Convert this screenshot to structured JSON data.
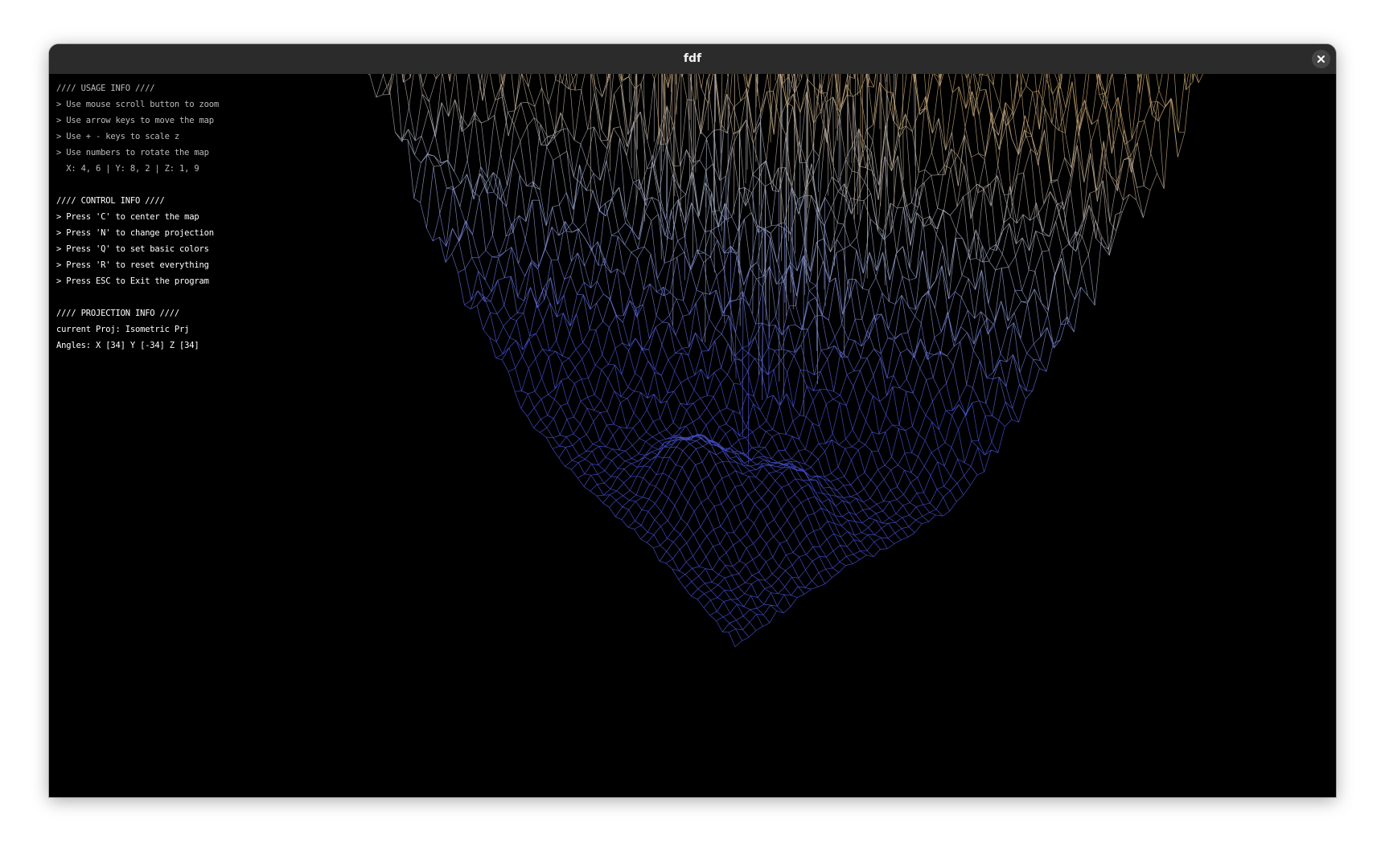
{
  "window": {
    "title": "fdf"
  },
  "icons": {
    "close": "close-icon"
  },
  "colors": {
    "titlebar": "#2b2b2b",
    "background": "#000000",
    "low": "#4a55e0",
    "mid": "#9aa7c8",
    "tan": "#c8a772",
    "high": "#e8e8e8",
    "green": "#8ab84a"
  },
  "hud": {
    "usage": {
      "header": "//// USAGE INFO ////",
      "lines": [
        "> Use mouse scroll button to zoom",
        "> Use arrow keys to move the map",
        "> Use + - keys to scale z",
        "> Use numbers to rotate the map",
        "  X: 4, 6 | Y: 8, 2 | Z: 1, 9"
      ]
    },
    "control": {
      "header": "//// CONTROL INFO ////",
      "lines": [
        "> Press 'C' to center the map",
        "> Press 'N' to change projection",
        "> Press 'Q' to set basic colors",
        "> Press 'R' to reset everything",
        "> Press ESC to Exit the program"
      ]
    },
    "projection": {
      "header": "//// PROJECTION INFO ////",
      "current": "current Proj: Isometric Prj",
      "angles": "Angles: X [34] Y [-34] Z [34]"
    }
  }
}
